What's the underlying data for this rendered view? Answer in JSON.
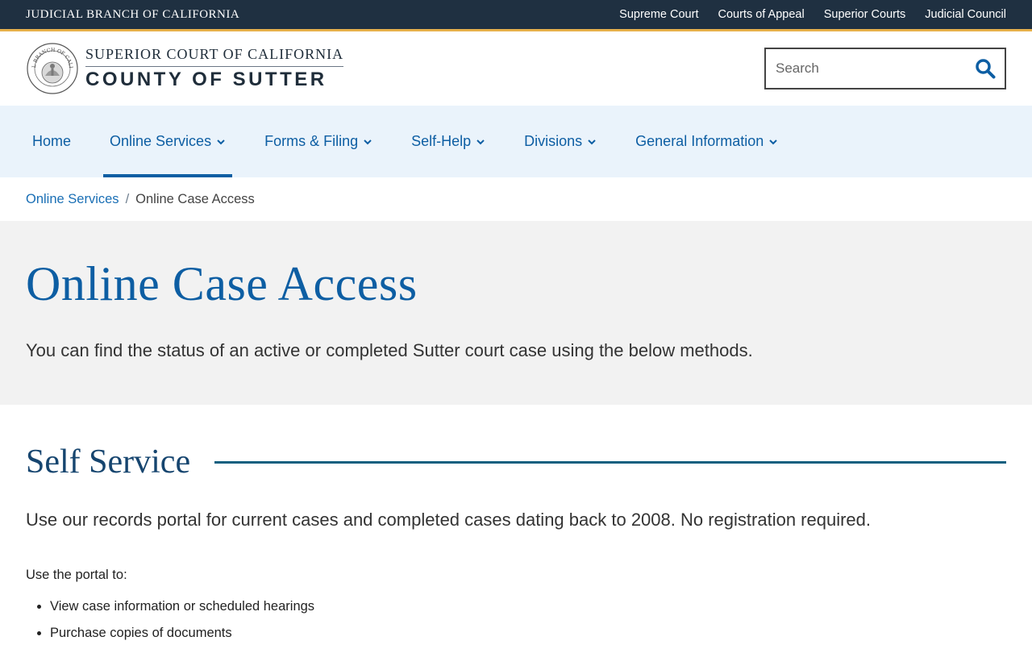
{
  "utility": {
    "branch": "JUDICIAL BRANCH OF CALIFORNIA",
    "links": [
      "Supreme Court",
      "Courts of Appeal",
      "Superior Courts",
      "Judicial Council"
    ]
  },
  "header": {
    "line1": "SUPERIOR COURT OF CALIFORNIA",
    "line2": "COUNTY OF SUTTER",
    "seal_text": "JUDICIAL BRANCH OF CALIFORNIA",
    "search_placeholder": "Search"
  },
  "nav": {
    "items": [
      {
        "label": "Home"
      },
      {
        "label": "Online Services"
      },
      {
        "label": "Forms & Filing"
      },
      {
        "label": "Self-Help"
      },
      {
        "label": "Divisions"
      },
      {
        "label": "General Information"
      }
    ]
  },
  "breadcrumb": {
    "parent": "Online Services",
    "separator": "/",
    "current": "Online Case Access"
  },
  "hero": {
    "title": "Online Case Access",
    "subtitle": "You can find the status of an active or completed Sutter court case using the below methods."
  },
  "section": {
    "title": "Self Service",
    "lead": "Use our records portal for current cases and completed cases dating back to 2008. No registration required.",
    "intro": "Use the portal to:",
    "items": [
      "View case information or scheduled hearings",
      "Purchase copies of documents"
    ]
  },
  "colors": {
    "utility_bg": "#1f3041",
    "accent_gold": "#e6b04a",
    "link_blue": "#0d5ea3",
    "nav_bg": "#eaf3fb",
    "hero_bg": "#f2f2f2",
    "section_title": "#16456f"
  }
}
